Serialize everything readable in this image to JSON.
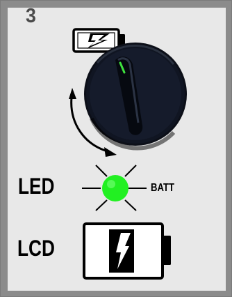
{
  "step": {
    "number": "3"
  },
  "labels": {
    "led": "LED",
    "batt": "BATT",
    "lcd": "LCD"
  },
  "icons": {
    "top_battery": "battery-lightning-icon",
    "knob": "rotary-knob-icon",
    "rotation": "curved-double-arrow-icon",
    "led": "green-led-glow-icon",
    "lcd_battery": "battery-lightning-icon"
  },
  "colors": {
    "frame": "#8b8b8b",
    "panel": "#e8e8e8",
    "step_number": "#4a4a4a",
    "led_green": "#22f022",
    "knob_body": "#0c0f18",
    "indicator": "#3ee03e"
  }
}
